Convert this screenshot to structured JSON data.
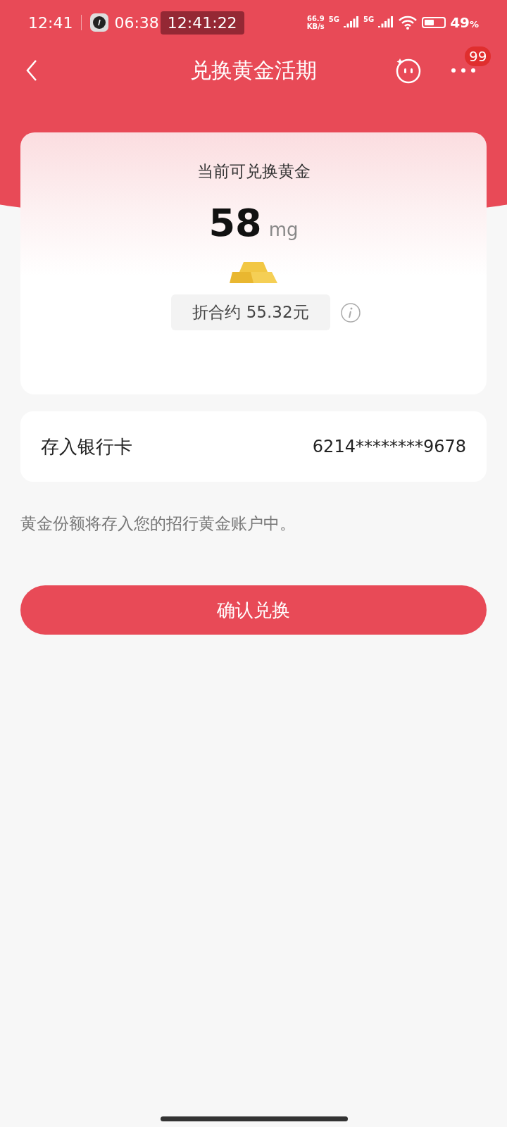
{
  "status_bar": {
    "time": "12:41",
    "clock_time": "06:38",
    "overlay_time": "12:41:22",
    "speed_value": "66.9",
    "speed_unit": "KB/s",
    "network_1": "5G",
    "network_2": "5G",
    "battery": "49",
    "battery_unit": "%"
  },
  "header": {
    "title": "兑换黄金活期",
    "badge": "99"
  },
  "gold_card": {
    "label": "当前可兑换黄金",
    "amount": "58",
    "unit": "mg",
    "approx": "折合约 55.32元"
  },
  "deposit": {
    "label": "存入银行卡",
    "card_number": "6214********9678"
  },
  "note": "黄金份额将存入您的招行黄金账户中。",
  "confirm_button": "确认兑换"
}
